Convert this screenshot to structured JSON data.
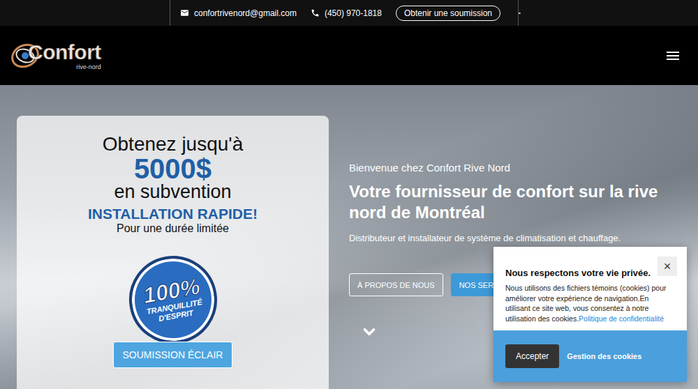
{
  "topbar": {
    "email": "confortrivenord@gmail.com",
    "phone": "(450) 970-1818",
    "quote_button": "Obtenir une soumission",
    "extra": "•"
  },
  "logo": {
    "name": "Confort",
    "tagline": "rive-nord"
  },
  "promo": {
    "line1": "Obtenez jusqu'à",
    "amount": "5000$",
    "line2": "en subvention",
    "highlight": "INSTALLATION RAPIDE!",
    "note": "Pour une durée limitée",
    "badge": {
      "percent": "100%",
      "lines": [
        "TRANQUILLITÉ",
        "D'ESPRIT"
      ]
    },
    "button": "SOUMISSION ÉCLAIR"
  },
  "hero": {
    "welcome": "Bienvenue chez Confort Rive Nord",
    "title": "Votre fournisseur de confort sur la rive nord de Montréal",
    "subtitle": "Distributeur et installateur de système de climatisation et chauffage.",
    "buttons": [
      {
        "label": "À PROPOS DE NOUS",
        "kind": "outline"
      },
      {
        "label": "NOS SERV",
        "kind": "filled"
      }
    ]
  },
  "cookie_banner": {
    "title": "Nous respectons votre vie privée.",
    "body": "Nous utilisons des fichiers témoins (cookies) pour améliorer votre expérience de navigation.En utilisant ce site web, vous consentez à notre utilisation des cookies.",
    "link": "Politique de confidentialité",
    "close": "×",
    "accept": "Accepter",
    "manage": "Gestion des cookies"
  }
}
